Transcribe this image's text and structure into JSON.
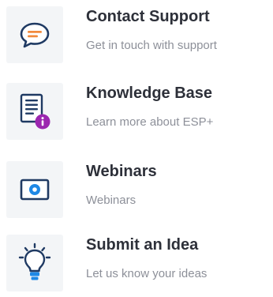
{
  "menu": {
    "items": [
      {
        "title": "Contact Support",
        "subtitle": "Get in touch with support",
        "icon": "chat-bubble-icon"
      },
      {
        "title": "Knowledge Base",
        "subtitle": "Learn more about ESP+",
        "icon": "document-info-icon"
      },
      {
        "title": "Webinars",
        "subtitle": "Webinars",
        "icon": "video-screen-icon"
      },
      {
        "title": "Submit an Idea",
        "subtitle": "Let us know your ideas",
        "icon": "lightbulb-icon"
      }
    ]
  },
  "colors": {
    "icon_navy": "#1f3a63",
    "accent_orange": "#f28a3c",
    "accent_blue": "#1e88e5",
    "accent_purple": "#9c27b0",
    "tile_bg": "#f3f5f7"
  }
}
